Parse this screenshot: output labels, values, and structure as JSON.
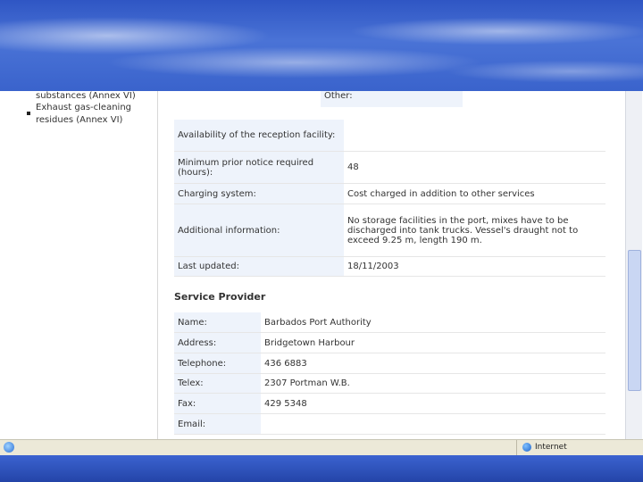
{
  "sidebar": {
    "items": [
      "substances (Annex VI)",
      "Exhaust gas-cleaning",
      "residues (Annex VI)"
    ]
  },
  "top_other": "Other:",
  "facility_rows": [
    {
      "label": "Availability of the reception facility:",
      "value": ""
    },
    {
      "label": "Minimum prior notice required (hours):",
      "value": "48"
    },
    {
      "label": "Charging system:",
      "value": "Cost charged in addition to other services"
    },
    {
      "label": "Additional information:",
      "value": "No storage facilities in the port, mixes have to be discharged into tank trucks. Vessel's draught not to exceed 9.25 m, length 190 m."
    },
    {
      "label": "Last updated:",
      "value": "18/11/2003"
    }
  ],
  "service_provider": {
    "title": "Service Provider",
    "rows": [
      {
        "label": "Name:",
        "value": "Barbados Port Authority"
      },
      {
        "label": "Address:",
        "value": "Bridgetown Harbour"
      },
      {
        "label": "Telephone:",
        "value": "436 6883"
      },
      {
        "label": "Telex:",
        "value": "2307 Portman W.B."
      },
      {
        "label": "Fax:",
        "value": "429 5348"
      },
      {
        "label": "Email:",
        "value": ""
      }
    ]
  },
  "status": {
    "zone": "Internet"
  },
  "icons": [
    "ie-page-icon",
    "internet-globe-icon"
  ]
}
